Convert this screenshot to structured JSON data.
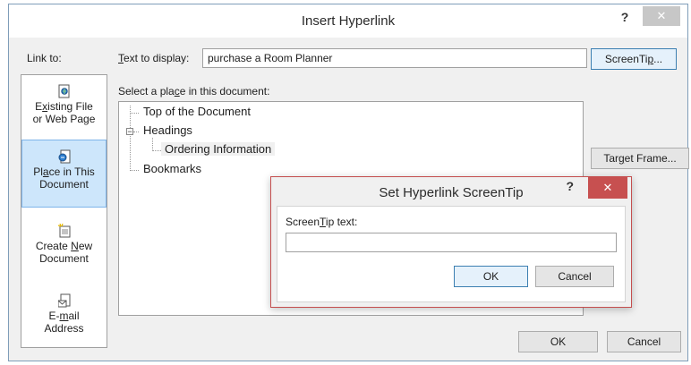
{
  "dialog": {
    "title": "Insert Hyperlink",
    "help_label": "?",
    "close_label": "✕",
    "link_to_label": "Link to:",
    "link_to_items": [
      {
        "line1_pre": "E",
        "line1_u": "x",
        "line1_post": "isting File",
        "line2": "or Web Page"
      },
      {
        "line1_pre": "Pl",
        "line1_u": "a",
        "line1_post": "ce in This",
        "line2": "Document"
      },
      {
        "line1_pre": "Create ",
        "line1_u": "N",
        "line1_post": "ew",
        "line2": "Document"
      },
      {
        "line1_pre": "E-",
        "line1_u": "m",
        "line1_post": "ail",
        "line2": "Address"
      }
    ],
    "text_to_display_label_u": "T",
    "text_to_display_label_rest": "ext to display:",
    "text_to_display_value": "purchase a Room Planner",
    "screentip_button_pre": "ScreenTi",
    "screentip_button_u": "p",
    "screentip_button_post": "...",
    "select_place_pre": "Select a pla",
    "select_place_u": "c",
    "select_place_post": "e in this document:",
    "tree": {
      "top_of_document": "Top of the Document",
      "headings": "Headings",
      "ordering_information": "Ordering Information",
      "bookmarks": "Bookmarks"
    },
    "target_frame_pre": "Tar",
    "target_frame_u": "g",
    "target_frame_post": "et Frame...",
    "ok_label": "OK",
    "cancel_label": "Cancel"
  },
  "screentip_dialog": {
    "title": "Set Hyperlink ScreenTip",
    "help_label": "?",
    "close_label": "✕",
    "field_label_pre": "Screen",
    "field_label_u": "T",
    "field_label_post": "ip text:",
    "field_value": "",
    "ok_label": "OK",
    "cancel_label": "Cancel"
  },
  "colors": {
    "selected_bg": "#cde6fb",
    "close_active": "#c75050"
  }
}
